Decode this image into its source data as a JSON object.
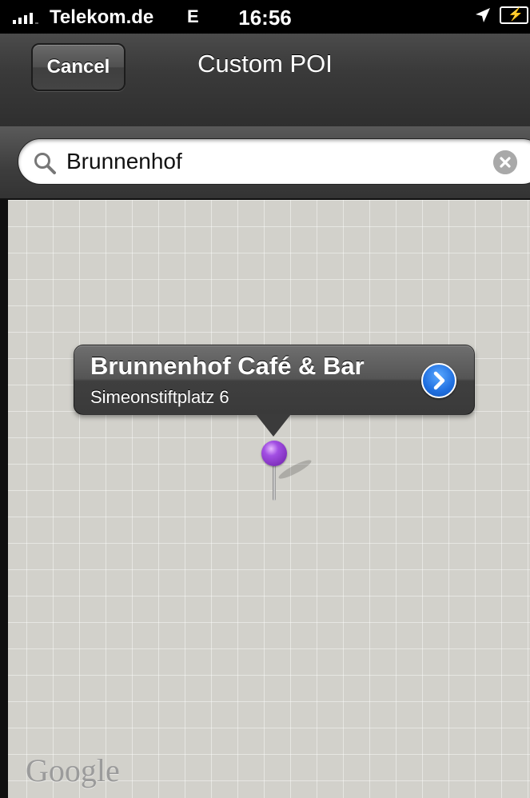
{
  "status_bar": {
    "carrier": "Telekom.de",
    "network_type": "E",
    "time": "16:56",
    "signal_icon": "signal-bars-icon",
    "location_icon": "location-arrow-icon",
    "battery_icon": "battery-charging-icon"
  },
  "nav": {
    "cancel_label": "Cancel",
    "title": "Custom POI"
  },
  "search": {
    "value": "Brunnenhof",
    "search_icon": "magnifier-icon",
    "clear_icon": "clear-x-icon"
  },
  "map": {
    "callout": {
      "title": "Brunnenhof Café & Bar",
      "subtitle": "Simeonstiftplatz 6",
      "disclosure_icon": "chevron-right-icon"
    },
    "pin_color": "#8a34c8",
    "attribution": "Google"
  }
}
